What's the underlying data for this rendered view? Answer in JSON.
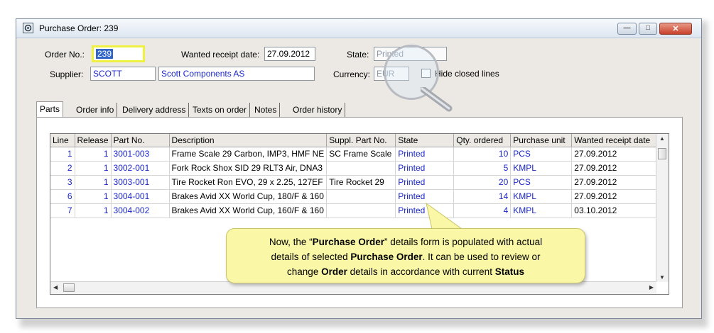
{
  "window": {
    "title": "Purchase Order: 239",
    "min": "—",
    "max": "□",
    "close": "✕"
  },
  "header": {
    "order_no_label": "Order No.:",
    "order_no_value": "239",
    "wanted_receipt_label": "Wanted receipt date:",
    "wanted_receipt_value": "27.09.2012",
    "state_label": "State:",
    "state_value": "Printed",
    "supplier_label": "Supplier:",
    "supplier_code": "SCOTT",
    "supplier_name": "Scott Components AS",
    "currency_label": "Currency:",
    "currency_value": "EUR",
    "hide_closed_label": "Hide closed lines"
  },
  "tabs": [
    "Parts",
    "Order info",
    "Delivery address",
    "Texts on order",
    "Notes",
    "Order history"
  ],
  "grid": {
    "columns": [
      "Line",
      "Release",
      "Part No.",
      "Description",
      "Suppl. Part No.",
      "State",
      "Qty. ordered",
      "Purchase unit",
      "Wanted receipt date"
    ],
    "rows": [
      [
        "1",
        "1",
        "3001-003",
        "Frame Scale 29 Carbon, IMP3, HMF NE",
        "SC Frame Scale",
        "Printed",
        "10",
        "PCS",
        "27.09.2012"
      ],
      [
        "2",
        "1",
        "3002-001",
        "Fork Rock Shox SID 29 RLT3 Air, DNA3",
        "",
        "Printed",
        "5",
        "KMPL",
        "27.09.2012"
      ],
      [
        "3",
        "1",
        "3003-001",
        "Tire Rocket Ron EVO, 29 x 2.25, 127EF",
        "Tire Rocket 29",
        "Printed",
        "20",
        "PCS",
        "27.09.2012"
      ],
      [
        "6",
        "1",
        "3004-001",
        "Brakes Avid XX World Cup, 180/F & 160",
        "",
        "Printed",
        "14",
        "KMPL",
        "27.09.2012"
      ],
      [
        "7",
        "1",
        "3004-002",
        "Brakes Avid XX World Cup, 160/F & 160",
        "",
        "Printed",
        "4",
        "KMPL",
        "03.10.2012"
      ]
    ]
  },
  "callout": {
    "p1": "Now, the “",
    "b1": "Purchase Order",
    "p2": "” details form is populated with actual",
    "p3": "details of selected ",
    "b2": "Purchase Order",
    "p4": ".  It can be used to review or",
    "p5": "change ",
    "b3": "Order",
    "p6": " details in accordance with current ",
    "b4": "Status"
  },
  "icons": {
    "app": "gear-window-icon",
    "magnifier": "magnifier-icon"
  },
  "colors": {
    "link_blue": "#1a26c8",
    "highlight_yellow": "#f0f040",
    "callout_bg": "#faf8a6"
  }
}
